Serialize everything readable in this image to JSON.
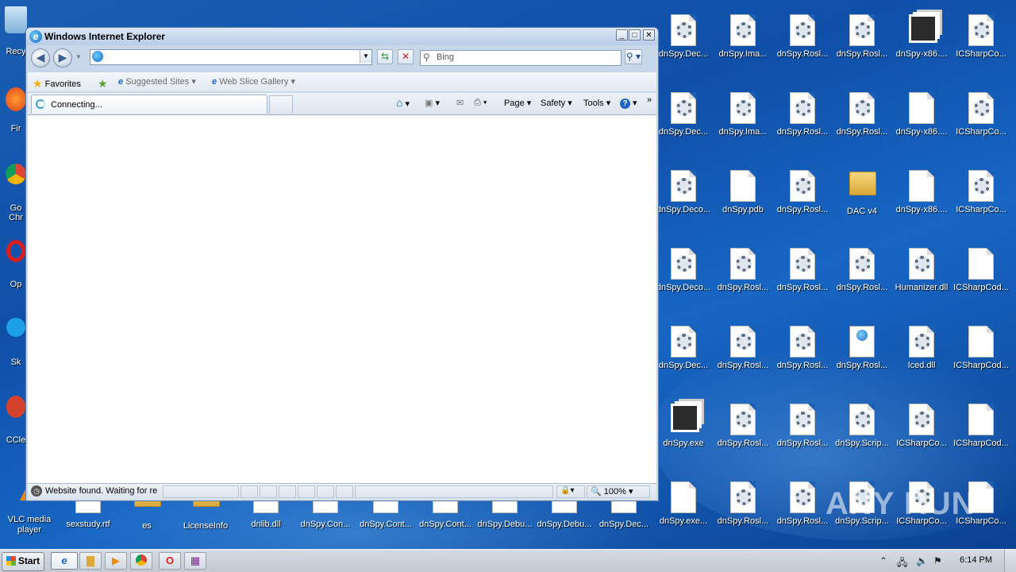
{
  "window": {
    "title": "Windows Internet Explorer",
    "address_value": "",
    "search_placeholder": "Bing",
    "favorites_label": "Favorites",
    "suggested_sites": "Suggested Sites",
    "web_slice_gallery": "Web Slice Gallery",
    "tab_label": "Connecting...",
    "commands": {
      "page": "Page",
      "safety": "Safety",
      "tools": "Tools"
    },
    "status_text": "Website found. Waiting for re",
    "zoom": "100%"
  },
  "desktop_left": [
    {
      "label": "Recy"
    },
    {
      "label": "Fir"
    },
    {
      "label": "Go Chr"
    },
    {
      "label": "Op"
    },
    {
      "label": "Sk"
    },
    {
      "label": "CCle"
    },
    {
      "label": "VLC media player"
    }
  ],
  "desktop_top_row": [
    "sexstudy.rtf",
    "es",
    "LicenseInfo",
    "dnlib.dll",
    "dnSpy.Con...",
    "dnSpy.Cont...",
    "dnSpy.Cont...",
    "dnSpy.Debu...",
    "dnSpy.Debu...",
    "dnSpy.Dec..."
  ],
  "desktop_grid": [
    [
      "dnSpy.Dec...",
      "dnSpy.Ima...",
      "dnSpy.Rosl...",
      "dnSpy.Rosl...",
      "dnSpy-x86....",
      "ICSharpCo..."
    ],
    [
      "dnSpy.Dec...",
      "dnSpy.Ima...",
      "dnSpy.Rosl...",
      "dnSpy.Rosl...",
      "dnSpy-x86....",
      "ICSharpCo..."
    ],
    [
      "dnSpy.Deco...",
      "dnSpy.pdb",
      "dnSpy.Rosl...",
      "DAC v4",
      "dnSpy-x86....",
      "ICSharpCo..."
    ],
    [
      "dnSpy.Deco...",
      "dnSpy.Rosl...",
      "dnSpy.Rosl...",
      "dnSpy.Rosl...",
      "Humanizer.dll",
      "ICSharpCod..."
    ],
    [
      "dnSpy.Dec...",
      "dnSpy.Rosl...",
      "dnSpy.Rosl...",
      "dnSpy.Rosl...",
      "Iced.dll",
      "ICSharpCod..."
    ],
    [
      "dnSpy.exe",
      "dnSpy.Rosl...",
      "dnSpy.Rosl...",
      "dnSpy.Scrip...",
      "ICSharpCo...",
      "ICSharpCod..."
    ],
    [
      "dnSpy.exe...",
      "dnSpy.Rosl...",
      "dnSpy.Rosl...",
      "dnSpy.Scrip...",
      "ICSharpCo...",
      "ICSharpCo..."
    ]
  ],
  "taskbar": {
    "start_label": "Start",
    "clock": "6:14 PM"
  },
  "watermark": "ANY RUN"
}
